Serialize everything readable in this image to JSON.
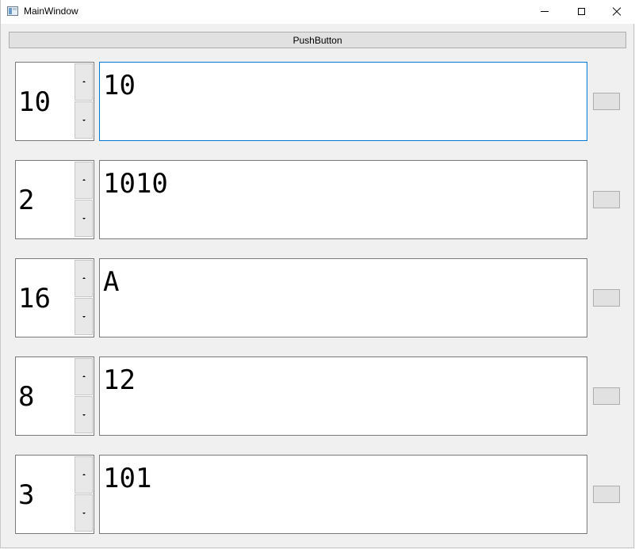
{
  "window": {
    "title": "MainWindow"
  },
  "toolbar": {
    "push_button_label": "PushButton"
  },
  "rows": [
    {
      "base": "10",
      "value": "10"
    },
    {
      "base": "2",
      "value": "1010"
    },
    {
      "base": "16",
      "value": "A"
    },
    {
      "base": "8",
      "value": "12"
    },
    {
      "base": "3",
      "value": "101"
    }
  ],
  "colors": {
    "focus_border": "#0078d7",
    "button_face": "#e1e1e1",
    "window_background": "#f0f0f0"
  }
}
